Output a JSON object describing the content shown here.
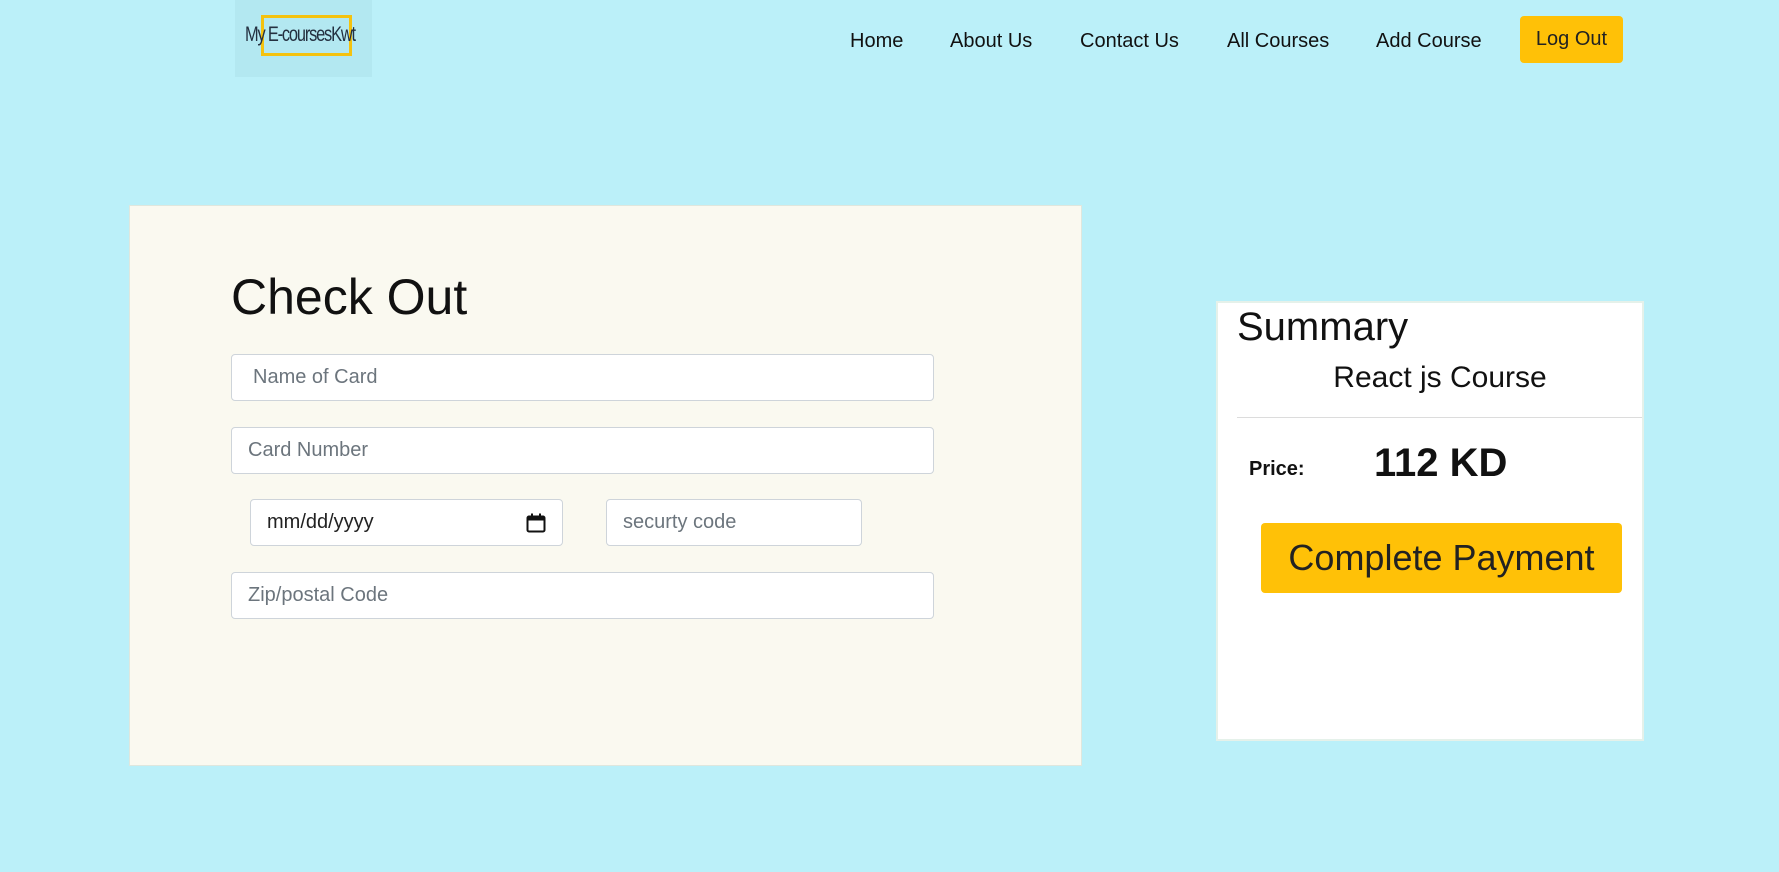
{
  "header": {
    "logo_text": "My E-coursesKwt",
    "nav": {
      "home": "Home",
      "about": "About Us",
      "contact": "Contact Us",
      "all_courses": "All Courses",
      "add_course": "Add Course"
    },
    "logout_label": "Log Out"
  },
  "checkout": {
    "title": "Check Out",
    "name_placeholder": "Name of Card",
    "card_placeholder": "Card Number",
    "date_value": "mm/dd/yyyy",
    "cvv_placeholder": "securty code",
    "zip_placeholder": "Zip/postal Code"
  },
  "summary": {
    "title": "Summary",
    "course_name": "React js Course",
    "price_label": "Price:",
    "price_value": "112 KD",
    "pay_label": "Complete Payment"
  },
  "colors": {
    "page_background": "#bbf0f9",
    "accent": "#ffc107",
    "checkout_panel": "#faf9f0",
    "summary_card": "#ffffff"
  },
  "icons": {
    "calendar": "calendar-icon"
  }
}
